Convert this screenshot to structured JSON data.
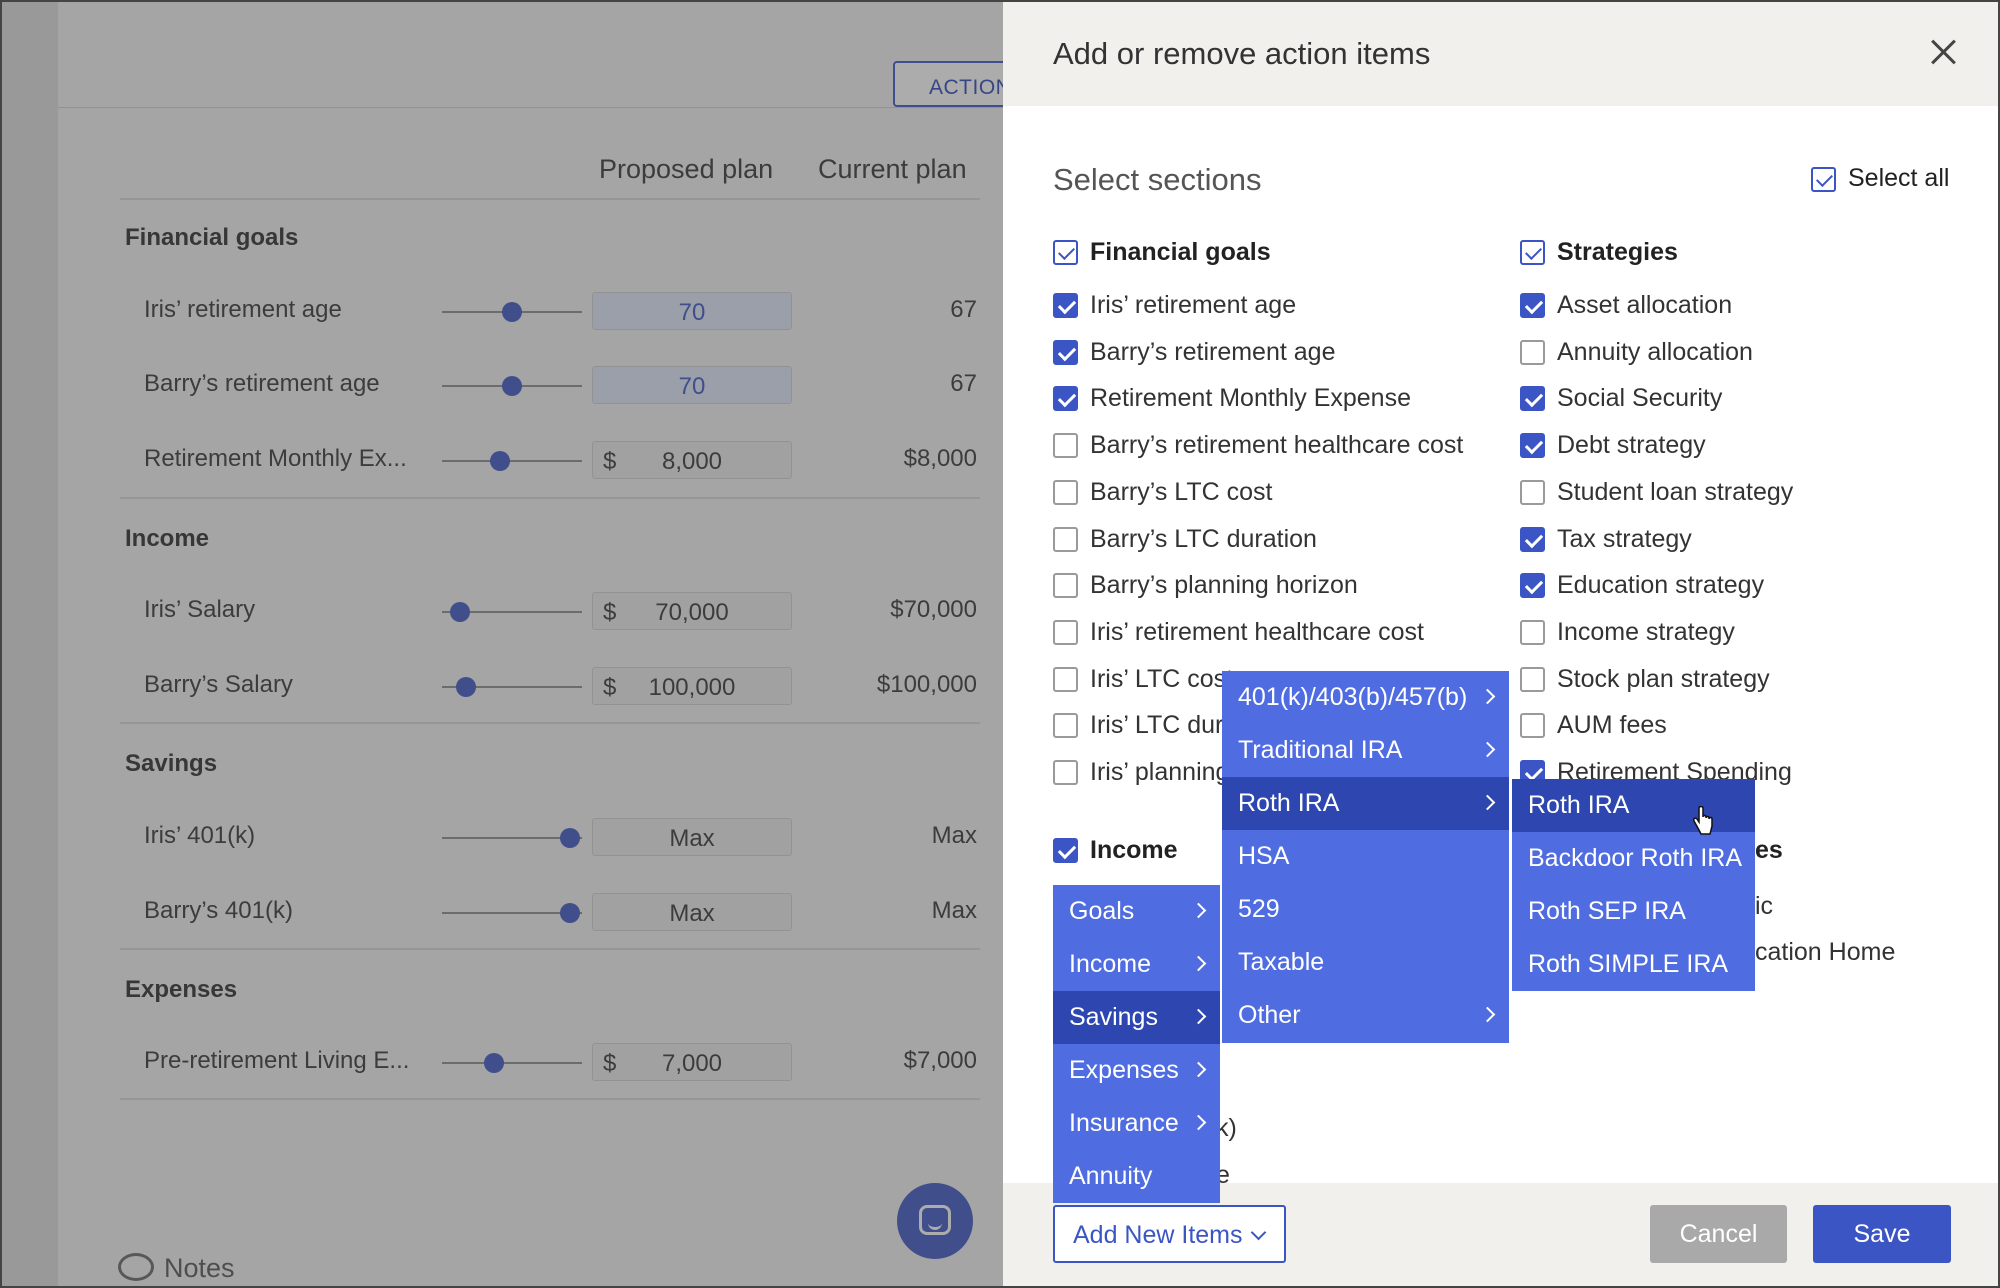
{
  "background": {
    "action_button": "ACTION",
    "col_proposed": "Proposed plan",
    "col_current": "Current plan",
    "sections": [
      {
        "title": "Financial goals",
        "rows": [
          {
            "label": "Iris’ retirement age",
            "value": "70",
            "current": "67"
          },
          {
            "label": "Barry’s retirement age",
            "value": "70",
            "current": "67"
          },
          {
            "label": "Retirement Monthly Ex...",
            "currency": "$",
            "value": "8,000",
            "current": "$8,000"
          }
        ]
      },
      {
        "title": "Income",
        "rows": [
          {
            "label": "Iris’ Salary",
            "currency": "$",
            "value": "70,000",
            "current": "$70,000"
          },
          {
            "label": "Barry’s Salary",
            "currency": "$",
            "value": "100,000",
            "current": "$100,000"
          }
        ]
      },
      {
        "title": "Savings",
        "rows": [
          {
            "label": "Iris’ 401(k)",
            "value": "Max",
            "current": "Max"
          },
          {
            "label": "Barry’s 401(k)",
            "value": "Max",
            "current": "Max"
          }
        ]
      },
      {
        "title": "Expenses",
        "rows": [
          {
            "label": "Pre-retirement Living E...",
            "currency": "$",
            "value": "7,000",
            "current": "$7,000"
          }
        ]
      }
    ],
    "notes_label": "Notes"
  },
  "modal": {
    "title": "Add or remove action items",
    "sections_title": "Select sections",
    "select_all": "Select all",
    "financial_goals": {
      "title": "Financial goals",
      "items": [
        {
          "label": "Iris’ retirement age",
          "checked": true
        },
        {
          "label": "Barry’s retirement age",
          "checked": true
        },
        {
          "label": "Retirement Monthly Expense",
          "checked": true
        },
        {
          "label": "Barry’s retirement healthcare cost",
          "checked": false
        },
        {
          "label": "Barry’s LTC cost",
          "checked": false
        },
        {
          "label": "Barry’s LTC duration",
          "checked": false
        },
        {
          "label": "Barry’s planning horizon",
          "checked": false
        },
        {
          "label": "Iris’ retirement healthcare cost",
          "checked": false
        },
        {
          "label": "Iris’ LTC cost",
          "checked": false
        },
        {
          "label": "Iris’ LTC dura",
          "checked": false
        },
        {
          "label": "Iris’ planning",
          "checked": false
        }
      ]
    },
    "income": {
      "title": "Income",
      "checked": true,
      "partial_text_1": "k)",
      "partial_text_2": "e"
    },
    "strategies": {
      "title": "Strategies",
      "items": [
        {
          "label": "Asset allocation",
          "checked": true
        },
        {
          "label": "Annuity allocation",
          "checked": false
        },
        {
          "label": "Social Security",
          "checked": true
        },
        {
          "label": "Debt strategy",
          "checked": true
        },
        {
          "label": "Student loan strategy",
          "checked": false
        },
        {
          "label": "Tax strategy",
          "checked": true
        },
        {
          "label": "Education strategy",
          "checked": true
        },
        {
          "label": "Income strategy",
          "checked": false
        },
        {
          "label": "Stock plan strategy",
          "checked": false
        },
        {
          "label": "AUM fees",
          "checked": false
        },
        {
          "label": "Retirement Spending",
          "checked": true
        }
      ],
      "partial_es": "es",
      "partial_ic": "ic",
      "partial_home": "cation Home"
    },
    "menu_level1": [
      "Goals",
      "Income",
      "Savings",
      "Expenses",
      "Insurance",
      "Annuity"
    ],
    "menu_level2": [
      "401(k)/403(b)/457(b)",
      "Traditional IRA",
      "Roth IRA",
      "HSA",
      "529",
      "Taxable",
      "Other"
    ],
    "menu_level3": [
      "Roth IRA",
      "Backdoor Roth IRA",
      "Roth SEP IRA",
      "Roth SIMPLE IRA"
    ],
    "add_new_items": "Add New Items",
    "cancel": "Cancel",
    "save": "Save"
  },
  "colors": {
    "accent": "#3b55c4",
    "menu": "#4f6ce0",
    "menu_active": "#2d46b0"
  },
  "icons": [
    "close-icon",
    "checkbox-icon",
    "chevron-right-icon",
    "chevron-down-icon",
    "chat-icon",
    "notes-icon",
    "hand-cursor-icon"
  ]
}
